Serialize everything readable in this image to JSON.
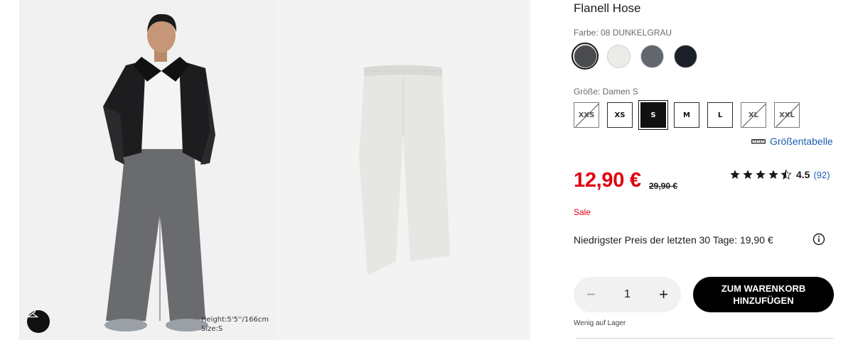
{
  "product": {
    "title": "Flanell Hose",
    "color_label": "Farbe: 08 DUNKELGRAU",
    "colors": [
      {
        "name": "dark-gray",
        "hex": "#4a4b4e",
        "selected": true
      },
      {
        "name": "off-white",
        "hex": "#ecebe6",
        "selected": false
      },
      {
        "name": "gray",
        "hex": "#62666f",
        "selected": false
      },
      {
        "name": "navy",
        "hex": "#1b2029",
        "selected": false
      }
    ],
    "size_label": "Größe: Damen S",
    "sizes": [
      {
        "label": "XXS",
        "state": "unavailable"
      },
      {
        "label": "XS",
        "state": "available"
      },
      {
        "label": "S",
        "state": "selected"
      },
      {
        "label": "M",
        "state": "available"
      },
      {
        "label": "L",
        "state": "available"
      },
      {
        "label": "XL",
        "state": "unavailable"
      },
      {
        "label": "XXL",
        "state": "unavailable"
      }
    ],
    "size_chart_label": "Größentabelle",
    "price": "12,90 €",
    "old_price": "29,90 €",
    "rating": {
      "stars": 4.5,
      "value": "4.5",
      "count": "(92)"
    },
    "sale_label": "Sale",
    "lowest_price_text": "Niedrigster Preis der letzten 30 Tage: 19,90 €",
    "quantity": "1",
    "add_to_cart": [
      "ZUM WARENKORB",
      "HINZUFÜGEN"
    ],
    "stock_text": "Wenig auf Lager"
  },
  "gallery": {
    "model_height": "Height:5'5''/166cm",
    "model_size": "Size:S"
  },
  "icons": {
    "hanger": "hanger-icon",
    "ruler": "ruler-icon",
    "info": "info-icon",
    "star": "star-icon"
  },
  "colors": {
    "sale_red": "#e00011",
    "link_blue": "#1a5fb4",
    "button_black": "#000000"
  }
}
